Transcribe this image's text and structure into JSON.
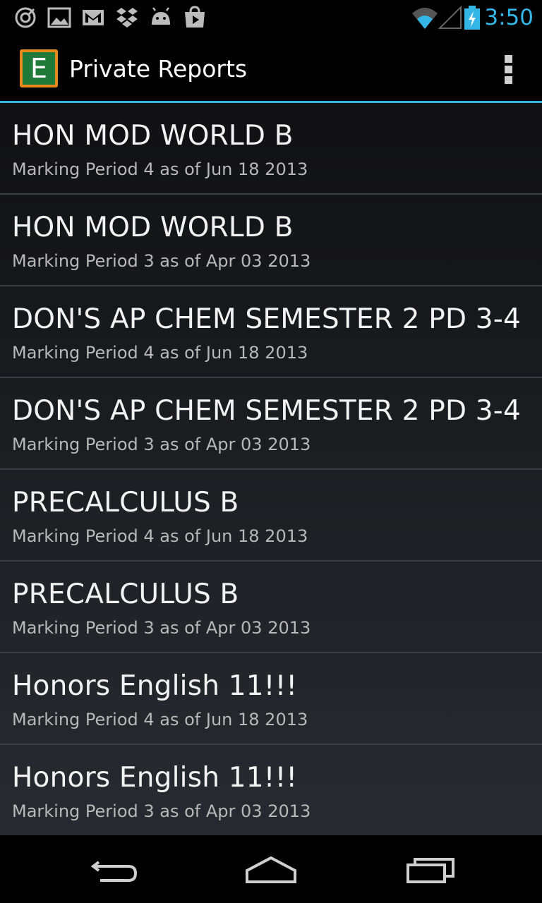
{
  "status_bar": {
    "left_icons": [
      "sync-icon",
      "gallery-icon",
      "gmail-icon",
      "dropbox-icon",
      "android-icon",
      "play-store-icon"
    ],
    "right_icons": [
      "wifi-icon",
      "signal-icon",
      "battery-charging-icon"
    ],
    "time": "3:50",
    "time_color": "#33b5e5"
  },
  "action_bar": {
    "logo_letter": "E",
    "title": "Private Reports",
    "accent_color": "#33b5e5",
    "overflow_icon": "overflow-menu-icon"
  },
  "reports": [
    {
      "title": "HON MOD WORLD B",
      "subtitle": "Marking Period 4 as of Jun 18 2013"
    },
    {
      "title": "HON MOD WORLD B",
      "subtitle": "Marking Period 3 as of Apr 03 2013"
    },
    {
      "title": "DON'S AP CHEM SEMESTER 2 PD 3-4",
      "subtitle": "Marking Period 4 as of Jun 18 2013"
    },
    {
      "title": "DON'S AP CHEM SEMESTER 2 PD 3-4",
      "subtitle": "Marking Period 3 as of Apr 03 2013"
    },
    {
      "title": "PRECALCULUS B",
      "subtitle": "Marking Period 4 as of Jun 18 2013"
    },
    {
      "title": "PRECALCULUS B",
      "subtitle": "Marking Period 3 as of Apr 03 2013"
    },
    {
      "title": "Honors English 11!!!",
      "subtitle": "Marking Period 4 as of Jun 18 2013"
    },
    {
      "title": "Honors English 11!!!",
      "subtitle": "Marking Period 3 as of Apr 03 2013"
    }
  ],
  "nav_bar": {
    "buttons": [
      "back-icon",
      "home-icon",
      "recent-apps-icon"
    ]
  }
}
